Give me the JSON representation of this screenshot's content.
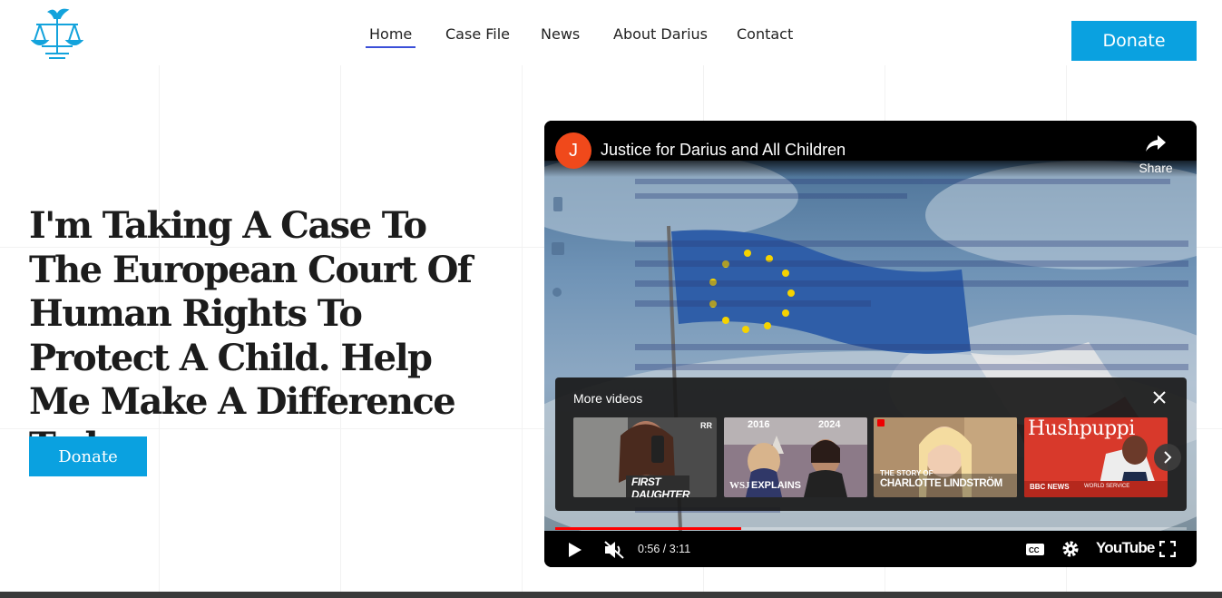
{
  "nav": {
    "items": [
      {
        "label": "Home",
        "active": true
      },
      {
        "label": "Case File",
        "active": false
      },
      {
        "label": "News",
        "active": false
      },
      {
        "label": "About Darius",
        "active": false
      },
      {
        "label": "Contact",
        "active": false
      }
    ],
    "donate_label": "Donate"
  },
  "hero": {
    "title": "I'm Taking A Case To The European Court Of Human Rights To Protect A Child. Help Me Make A Difference Today.",
    "donate_label": "Donate"
  },
  "video": {
    "channel_initial": "J",
    "title": "Justice for Darius and All Children",
    "share_label": "Share",
    "more_videos_label": "More videos",
    "progress": 0.294,
    "time": "0:56 / 3:11",
    "platform": "YouTube",
    "thumbnails": [
      {
        "caption": "FIRST DAUGHTER",
        "corner": "RR"
      },
      {
        "caption": "EXPLAINS",
        "brand": "WSJ",
        "year_left": "2016",
        "year_right": "2024"
      },
      {
        "caption_top": "THE STORY OF",
        "caption": "CHARLOTTE LINDSTRÖM"
      },
      {
        "caption": "Hushpuppi",
        "brand": "BBC NEWS",
        "subbrand": "WORLD SERVICE"
      }
    ]
  },
  "colors": {
    "accent": "#0aa1e0",
    "nav_underline": "#3b4fd8",
    "channel_avatar": "#f0491b",
    "progress": "#ff0000"
  }
}
